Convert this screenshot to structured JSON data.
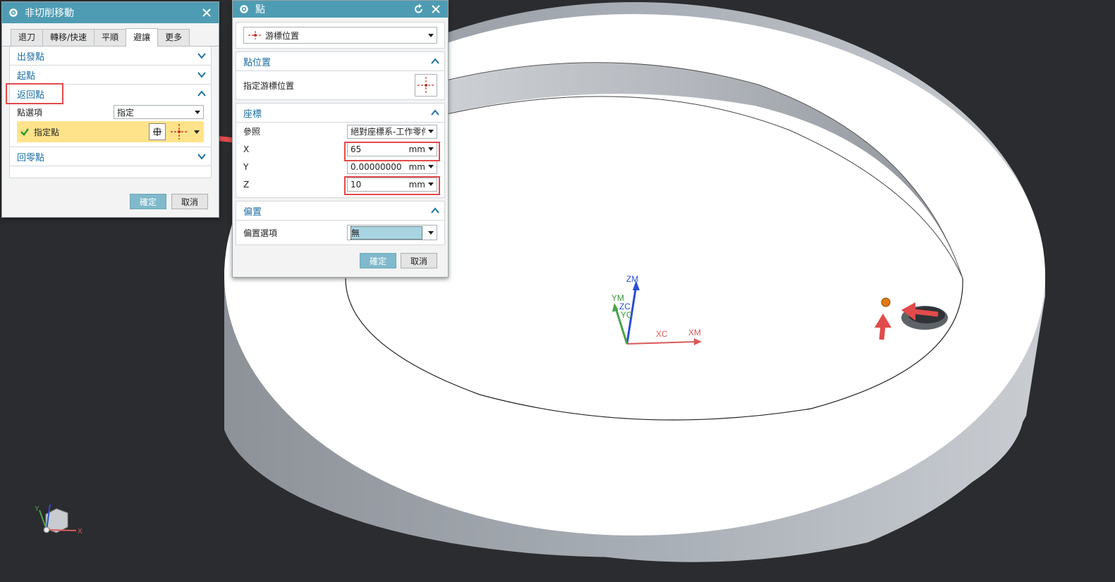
{
  "noncut_dialog": {
    "title": "非切削移動",
    "tabs": [
      "退刀",
      "轉移/快速",
      "平順",
      "避讓",
      "更多"
    ],
    "active_tab": "避讓",
    "sections": {
      "from_point": "出發點",
      "start_point": "起點",
      "return_point": "返回點",
      "home_point": "回零點"
    },
    "point_option_label": "點選項",
    "point_option_value": "指定",
    "specify_point_label": "指定點",
    "ok": "確定",
    "cancel": "取消"
  },
  "point_dialog": {
    "title": "點",
    "type_value": "游標位置",
    "section_location": "點位置",
    "specify_cursor_label": "指定游標位置",
    "section_coords": "座標",
    "reference_label": "參照",
    "reference_value": "絕對座標系-工作零件",
    "x_label": "X",
    "x_value": "65",
    "y_label": "Y",
    "y_value": "0.00000000",
    "z_label": "Z",
    "z_value": "10",
    "unit": "mm",
    "section_offset": "偏置",
    "offset_option_label": "偏置選項",
    "offset_option_value": "無",
    "ok": "確定",
    "cancel": "取消"
  },
  "triad": {
    "zm": "ZM",
    "ym": "YM",
    "zc": "ZC",
    "yc": "YC",
    "xc": "XC",
    "xm": "XM"
  },
  "mini_triad": {
    "y": "Y",
    "x": "X"
  },
  "colors": {
    "background": "#2a2c2f",
    "titlebar": "#4e9cb3",
    "highlight": "#ffe38a",
    "annotation": "#e24b4b",
    "point_marker": "#e07b12"
  }
}
